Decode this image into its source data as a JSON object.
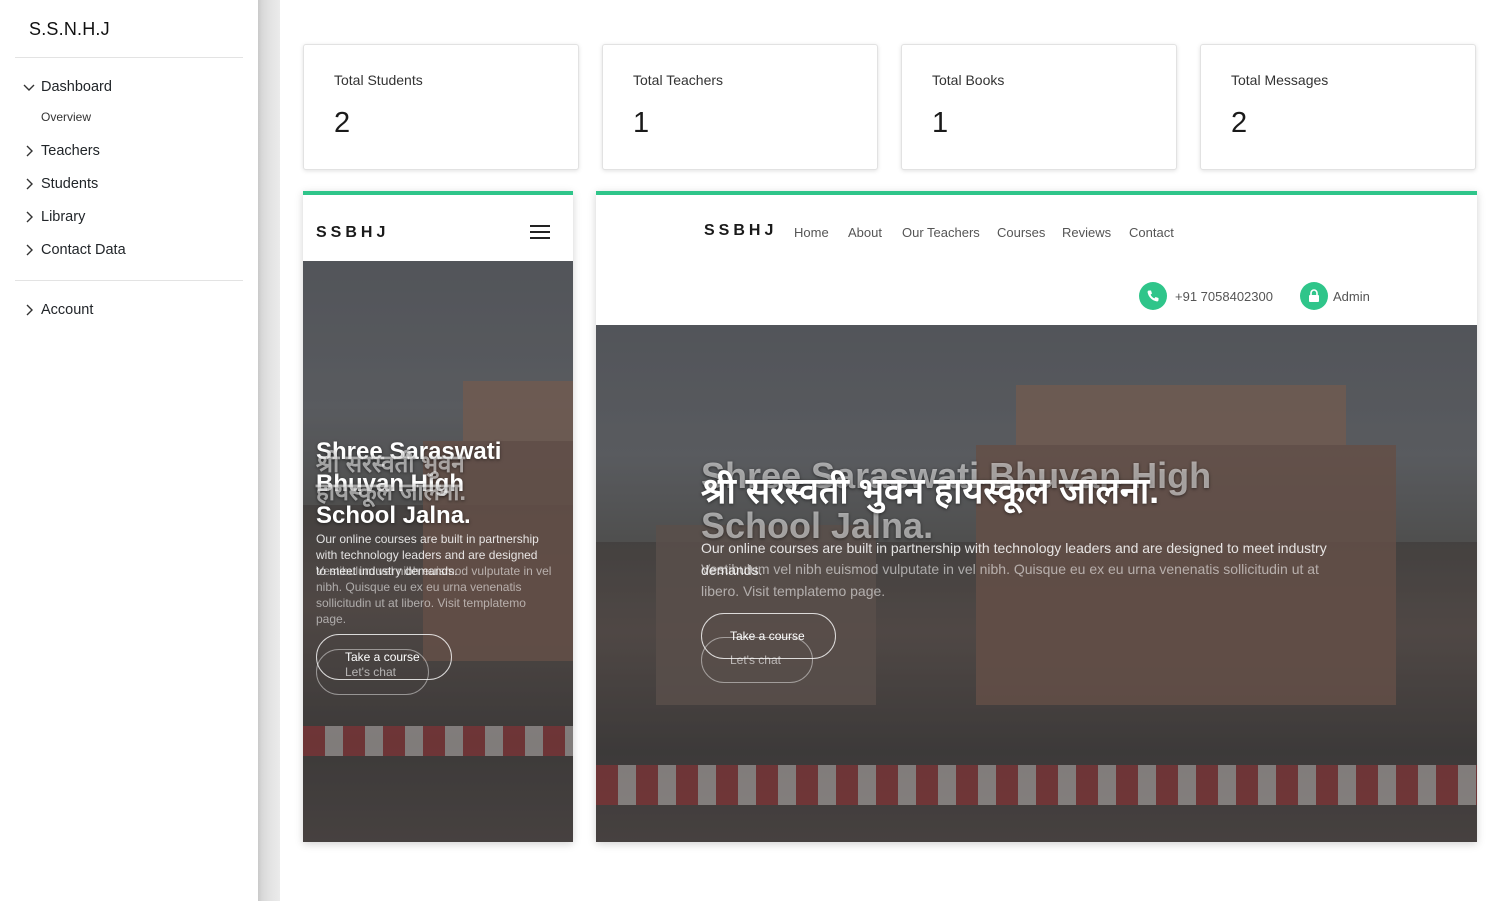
{
  "sidebar": {
    "brand": "S.S.N.H.J",
    "items": [
      {
        "label": "Dashboard",
        "expanded": true
      },
      {
        "label": "Teachers"
      },
      {
        "label": "Students"
      },
      {
        "label": "Library"
      },
      {
        "label": "Contact Data"
      }
    ],
    "sub_items": [
      {
        "label": "Overview"
      }
    ],
    "account": {
      "label": "Account"
    }
  },
  "stats": [
    {
      "label": "Total Students",
      "value": "2"
    },
    {
      "label": "Total Teachers",
      "value": "1"
    },
    {
      "label": "Total Books",
      "value": "1"
    },
    {
      "label": "Total Messages",
      "value": "2"
    }
  ],
  "site": {
    "logo": "SSBHJ",
    "nav": [
      "Home",
      "About",
      "Our Teachers",
      "Courses",
      "Reviews",
      "Contact"
    ],
    "phone": "+91 7058402300",
    "admin": "Admin",
    "title_en": "Shree Saraswati Bhuvan High School Jalna.",
    "title_hi": "श्री सरस्वती भुवन हायस्कूल जालना.",
    "description": "Our online courses are built in partnership with technology leaders and are designed to meet industry demands.",
    "description_ghost": "Vestibulum vel nibh euismod vulputate in vel nibh. Quisque eu ex eu urna venenatis sollicitudin ut at libero. Visit templatemo page.",
    "btn_course": "Take a course",
    "btn_chat": "Let's chat"
  },
  "colors": {
    "accent": "#2fc58a"
  },
  "icons": {
    "menu": "hamburger-icon",
    "phone": "phone-icon",
    "admin": "lock-icon"
  }
}
